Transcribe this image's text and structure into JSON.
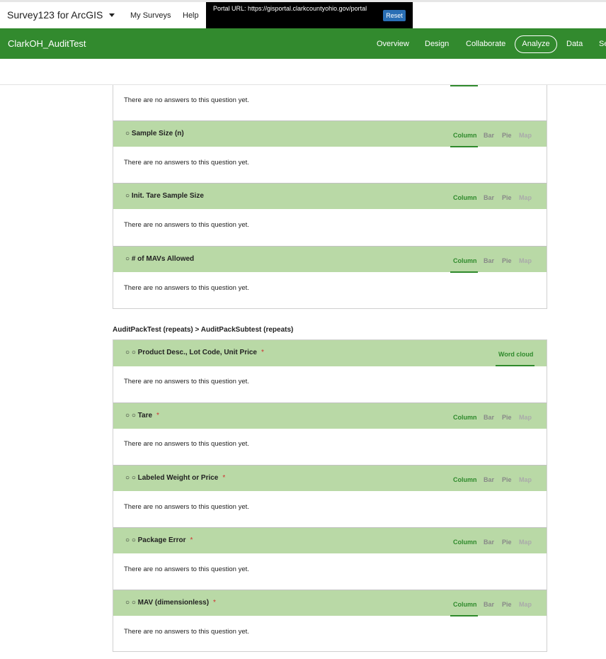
{
  "topbar": {
    "app_title": "Survey123 for ArcGIS",
    "links": [
      "My Surveys",
      "Help"
    ],
    "portal_label": "Portal URL: https://gisportal.clarkcountyohio.gov/portal",
    "reset_label": "Reset"
  },
  "header": {
    "survey_name": "ClarkOH_AuditTest",
    "tabs": [
      "Overview",
      "Design",
      "Collaborate",
      "Analyze",
      "Data",
      "Se"
    ],
    "active_tab": "Analyze"
  },
  "view_tabs": {
    "column": "Column",
    "bar": "Bar",
    "pie": "Pie",
    "map": "Map",
    "word_cloud": "Word cloud"
  },
  "no_answers": "There are no answers to this question yet.",
  "group1": {
    "questions": [
      {
        "title": "○ Sample Size (n)",
        "required": ""
      },
      {
        "title": "○ Init. Tare Sample Size",
        "required": ""
      },
      {
        "title": "○ # of MAVs Allowed",
        "required": ""
      }
    ]
  },
  "section_label": "AuditPackTest (repeats) > AuditPackSubtest (repeats)",
  "group2": {
    "questions": [
      {
        "title": "○ ○ Product Desc., Lot Code, Unit Price",
        "required": "*"
      },
      {
        "title": "○ ○ Tare",
        "required": "*"
      },
      {
        "title": "○ ○ Labeled Weight or Price",
        "required": "*"
      },
      {
        "title": "○ ○ Package Error",
        "required": "*"
      },
      {
        "title": "○ ○ MAV (dimensionless)",
        "required": "*"
      }
    ]
  }
}
